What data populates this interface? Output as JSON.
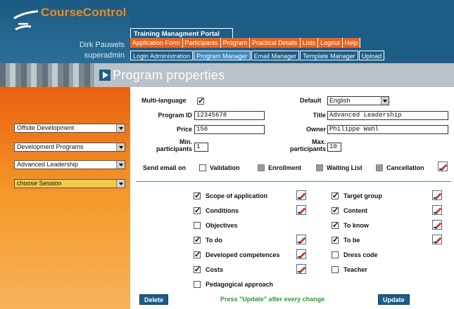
{
  "app": {
    "logo": "CourseControl",
    "user_name": "Dirk Pauwels",
    "user_role": "superadmin",
    "portal_title": "Training Managment Portal",
    "page_title": "Program properties"
  },
  "nav_primary": [
    "Application Form",
    "Participants",
    "Program",
    "Practical Details",
    "Lists",
    "Logout",
    "Help"
  ],
  "nav_secondary": [
    "Login Administration",
    "Program Manager",
    "Email Manager",
    "Template Manager",
    "Upload"
  ],
  "sidebar": {
    "filters": [
      "Offsite Development",
      "Development Programs",
      "Advanced Leadership",
      "choose Session"
    ]
  },
  "form": {
    "multilanguage_label": "Multi-language",
    "default_label": "Default",
    "default_value": "English",
    "program_id_label": "Program ID",
    "program_id_value": "12345678",
    "title_label": "Title",
    "title_value": "Advanced Leadership",
    "price_label": "Price",
    "price_value": "150",
    "owner_label": "Owner",
    "owner_value": "Philippe Wahl",
    "min_label_1": "Min.",
    "min_label_2": "participants",
    "min_value": "1",
    "max_label_1": "Max.",
    "max_label_2": "participants",
    "max_value": "10",
    "send_email_label": "Send email on",
    "email_options": [
      "Validation",
      "Enrollment",
      "Waiting List",
      "Cancellation"
    ]
  },
  "sections_left": [
    "Scope of application",
    "Conditions",
    "Objectives",
    "To do",
    "Developed competences",
    "Costs",
    "Pedagogical approach"
  ],
  "sections_right": [
    "Target group",
    "Content",
    "To know",
    "To be",
    "Dress code",
    "Teacher"
  ],
  "actions": {
    "delete_label": "Delete",
    "hint": "Press \"Update\" after every change",
    "update_label": "Update"
  }
}
